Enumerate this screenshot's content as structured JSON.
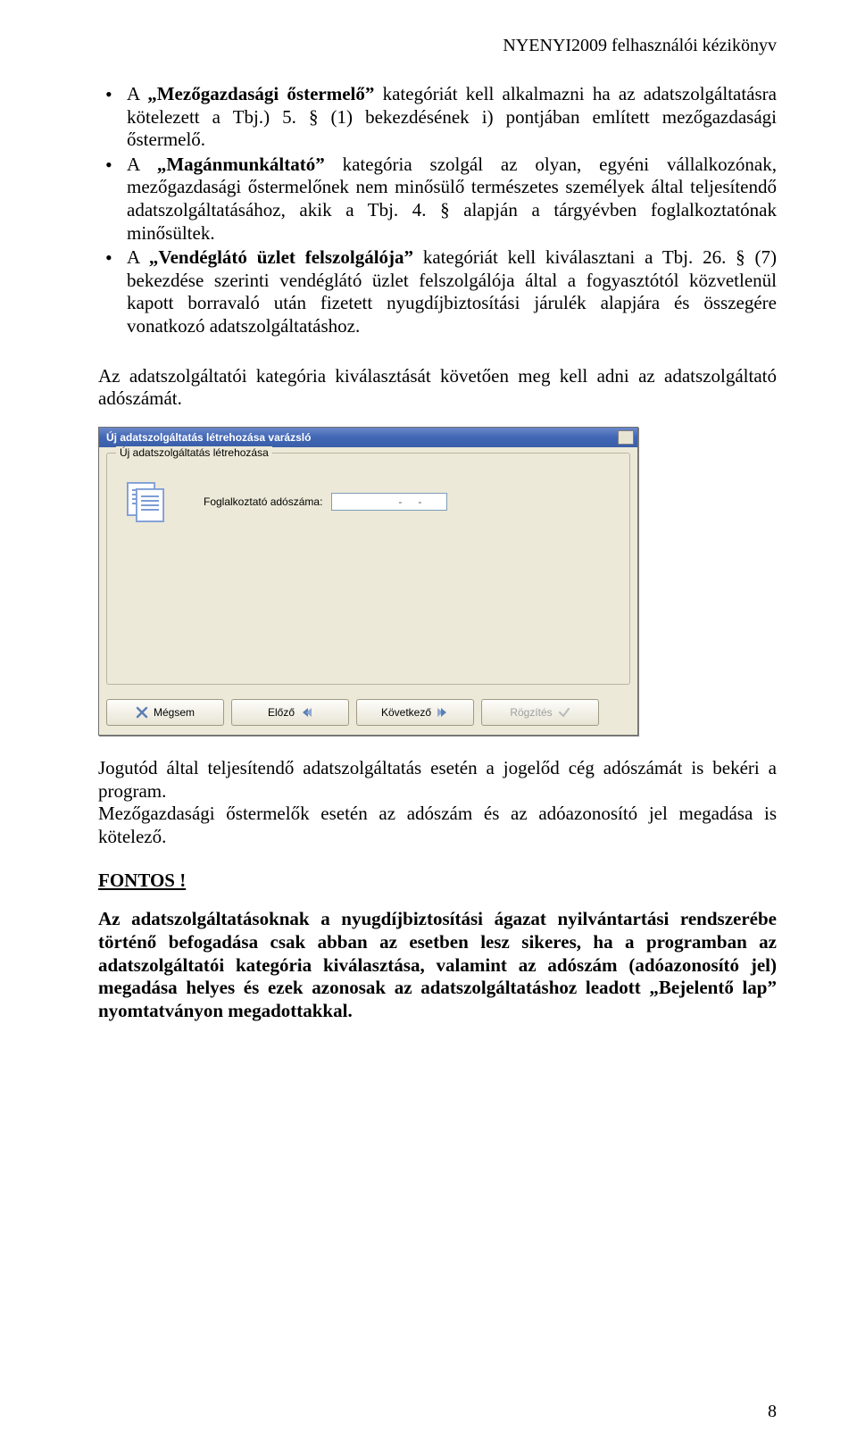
{
  "header": "NYENYI2009 felhasználói kézikönyv",
  "bullets": [
    {
      "pre": "A ",
      "bold": "„Mezőgazdasági őstermelő”",
      "post": " kategóriát kell alkalmazni ha az adatszolgáltatásra kötelezett a Tbj.) 5. § (1) bekezdésének i) pontjában említett mezőgazdasági őstermelő."
    },
    {
      "pre": "A ",
      "bold": "„Magánmunkáltató”",
      "post": " kategória szolgál az olyan, egyéni vállalkozónak, mezőgazdasági őstermelőnek nem minősülő természetes személyek által teljesítendő adatszolgáltatásához, akik a Tbj. 4. § alapján a tárgyévben foglalkoztatónak minősültek."
    },
    {
      "pre": "A ",
      "bold": "„Vendéglátó üzlet felszolgálója”",
      "post": " kategóriát kell kiválasztani a Tbj. 26. § (7) bekezdése szerinti vendéglátó üzlet felszolgálója által a fogyasztótól közvetlenül kapott borravaló után fizetett nyugdíjbiztosítási járulék alapjára és összegére vonatkozó adatszolgáltatáshoz."
    }
  ],
  "para_after_bullets": "Az adatszolgáltatói kategória kiválasztását követően meg kell adni az adatszolgáltató adószámát.",
  "dialog": {
    "title": "Új adatszolgáltatás létrehozása varázsló",
    "group_title": "Új adatszolgáltatás létrehozása",
    "field_label": "Foglalkoztató adószáma:",
    "buttons": {
      "cancel": "Mégsem",
      "prev": "Előző",
      "next": "Következő",
      "save": "Rögzítés"
    }
  },
  "para_after_dialog1": "Jogutód által teljesítendő adatszolgáltatás esetén a jogelőd cég adószámát is bekéri a program.",
  "para_after_dialog2": "Mezőgazdasági őstermelők esetén az adószám és az adóazonosító jel megadása is kötelező.",
  "fontos": "FONTOS !",
  "bold_para": "Az adatszolgáltatásoknak a nyugdíjbiztosítási ágazat nyilvántartási rendszerébe történő befogadása csak abban az esetben lesz sikeres, ha a programban az adatszolgáltatói kategória kiválasztása, valamint az adószám (adóazonosító jel) megadása helyes és ezek azonosak az adatszolgáltatáshoz leadott „Bejelentő lap” nyomtatványon megadottakkal.",
  "page_number": "8"
}
